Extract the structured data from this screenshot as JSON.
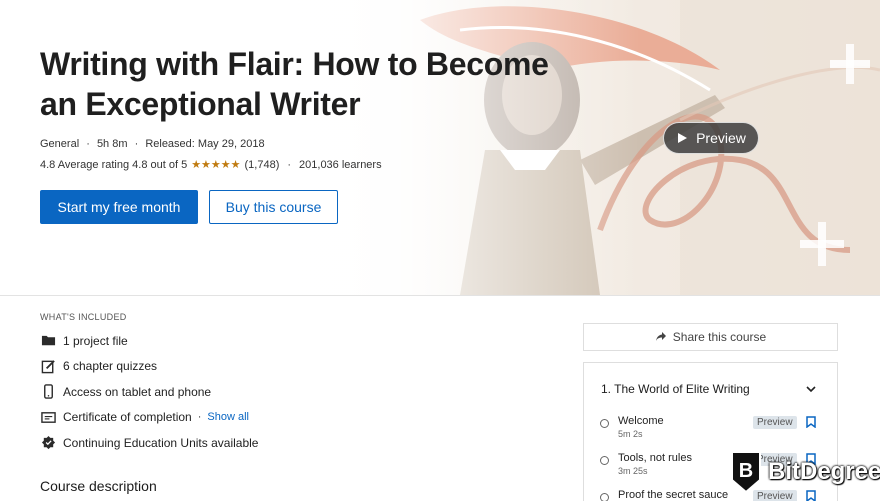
{
  "course": {
    "title": "Writing with Flair: How to Become an Exceptional Writer",
    "category": "General",
    "duration": "5h 8m",
    "released": "Released: May 29, 2018",
    "rating_text": "4.8 Average rating 4.8 out of 5",
    "stars": "★★★★★",
    "rating_count": "(1,748)",
    "learners": "201,036 learners",
    "dot": "·"
  },
  "buttons": {
    "start": "Start my free month",
    "buy": "Buy this course",
    "preview": "Preview"
  },
  "included": {
    "label": "WHAT'S INCLUDED",
    "items": [
      {
        "icon": "folder-icon",
        "text": "1 project file"
      },
      {
        "icon": "quiz-icon",
        "text": "6 chapter quizzes"
      },
      {
        "icon": "phone-icon",
        "text": "Access on tablet and phone"
      },
      {
        "icon": "certificate-icon",
        "text": "Certificate of completion"
      },
      {
        "icon": "badge-icon",
        "text": "Continuing Education Units available"
      }
    ],
    "show_all": "Show all",
    "show_all_dot": "·"
  },
  "description_heading": "Course description",
  "sidebar": {
    "share": "Share this course",
    "chapter_title": "1. The World of Elite Writing",
    "lessons": [
      {
        "title": "Welcome",
        "duration": "5m 2s",
        "badge": "Preview"
      },
      {
        "title": "Tools, not rules",
        "duration": "3m 25s",
        "badge": "Preview"
      },
      {
        "title": "Proof the secret sauce",
        "duration": "",
        "badge": "Preview"
      }
    ]
  },
  "watermark": {
    "text": "BitDegree",
    "badge_letter": "B"
  },
  "colors": {
    "accent": "#0a66c2",
    "star": "#c07b10",
    "hero_art": "#e8a58c"
  }
}
